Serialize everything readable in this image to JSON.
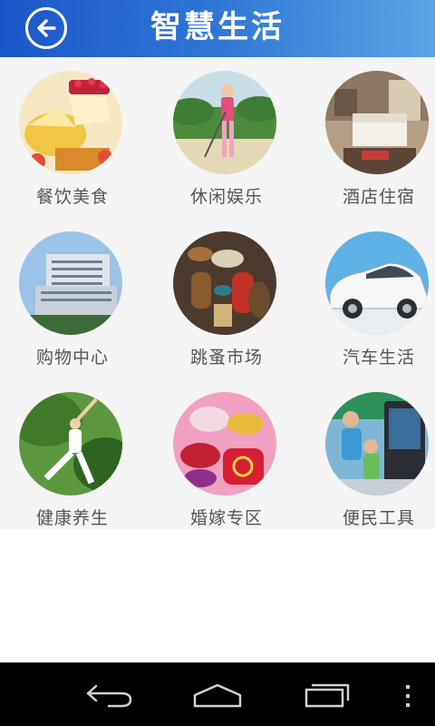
{
  "header": {
    "title": "智慧生活",
    "back_icon": "back-arrow-icon"
  },
  "categories": [
    {
      "label": "餐饮美食",
      "icon": "food-dessert-photo"
    },
    {
      "label": "休闲娱乐",
      "icon": "golf-photo"
    },
    {
      "label": "酒店住宿",
      "icon": "hotel-room-photo"
    },
    {
      "label": "购物中心",
      "icon": "building-photo"
    },
    {
      "label": "跳蚤市场",
      "icon": "antiques-photo"
    },
    {
      "label": "汽车生活",
      "icon": "car-photo"
    },
    {
      "label": "健康养生",
      "icon": "yoga-photo"
    },
    {
      "label": "婚嫁专区",
      "icon": "wedding-items-photo"
    },
    {
      "label": "便民工具",
      "icon": "kiosk-kids-photo"
    }
  ],
  "navigation_bar": {
    "back": "nav-back-icon",
    "home": "nav-home-icon",
    "recent": "nav-recent-apps-icon",
    "menu": "nav-menu-icon"
  },
  "colors": {
    "header_start": "#1b56c9",
    "header_end": "#58a4e4",
    "label": "#555555",
    "grid_bg": "#f4f4f4"
  }
}
